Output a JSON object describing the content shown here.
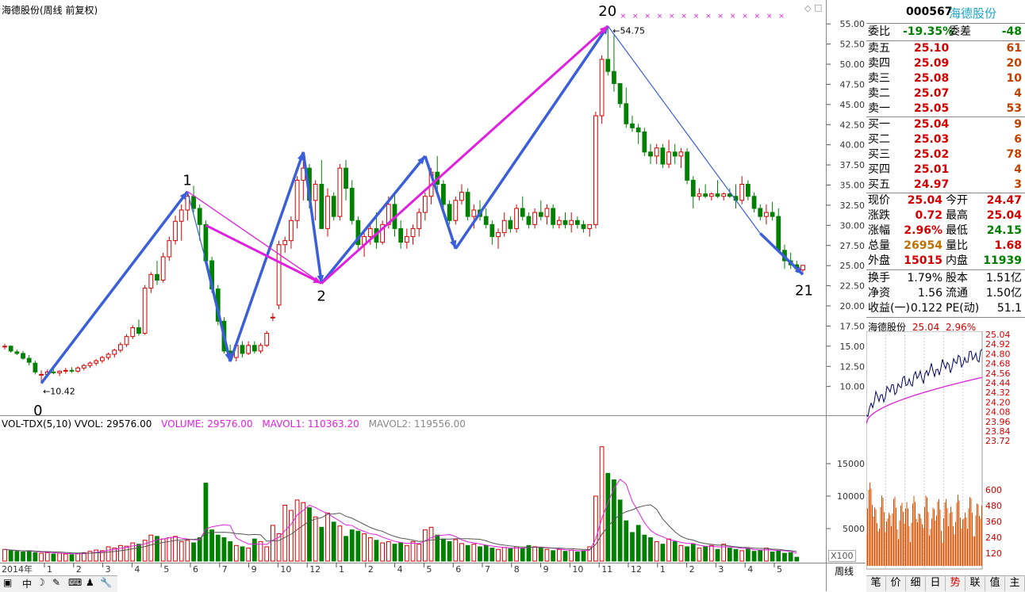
{
  "chart_title": "海德股份(周线 前复权)",
  "vol_indicator": {
    "name": "VOL-TDX(5,10)",
    "vvol_label": "VVOL:",
    "vvol": "29576.00",
    "volume_label": "VOLUME:",
    "volume": "29576.00",
    "mavol1_label": "MAVOL1:",
    "mavol1": "110363.20",
    "mavol2_label": "MAVOL2:",
    "mavol2": "119556.00"
  },
  "annotations": {
    "wave_0": "0",
    "wave_1": "1",
    "wave_2": "2",
    "wave_20": "20",
    "wave_21": "21",
    "low_price": "10.42",
    "high_price": "54.75"
  },
  "x_axis": {
    "year_label": "2014年",
    "months": [
      "1",
      "2",
      "3",
      "4",
      "5",
      "6",
      "7",
      "9",
      "10",
      "12",
      "1",
      "2",
      "4",
      "5",
      "6",
      "7",
      "8",
      "9",
      "10",
      "11",
      "12",
      "1",
      "2",
      "3",
      "4",
      "5"
    ],
    "period_label": "周线",
    "zoom_label": "X100"
  },
  "chart_data": [
    {
      "type": "candlestick",
      "title": "海德股份(周线 前复权)",
      "y_ticks": [
        "55.00",
        "52.50",
        "50.00",
        "47.50",
        "45.00",
        "42.50",
        "40.00",
        "37.50",
        "35.00",
        "32.50",
        "30.00",
        "27.50",
        "25.00",
        "22.50",
        "20.00",
        "17.50",
        "15.00",
        "12.50",
        "10.00"
      ],
      "ylim": [
        8.0,
        56.0
      ],
      "candles": [
        [
          15.0,
          15.3,
          14.6,
          15.0
        ],
        [
          15.0,
          15.1,
          14.2,
          14.4
        ],
        [
          14.3,
          14.6,
          13.9,
          14.1
        ],
        [
          14.1,
          14.4,
          13.3,
          13.5
        ],
        [
          13.5,
          13.9,
          12.6,
          13.0
        ],
        [
          12.9,
          13.2,
          11.5,
          11.8
        ],
        [
          11.5,
          12.0,
          10.4,
          11.5
        ],
        [
          11.5,
          12.1,
          11.2,
          11.8
        ],
        [
          11.8,
          12.3,
          11.5,
          11.7
        ],
        [
          11.7,
          12.0,
          11.3,
          11.9
        ],
        [
          11.9,
          12.3,
          11.6,
          12.0
        ],
        [
          12.0,
          12.4,
          11.7,
          11.9
        ],
        [
          11.9,
          12.5,
          11.7,
          12.3
        ],
        [
          12.3,
          12.8,
          12.0,
          12.6
        ],
        [
          12.6,
          13.1,
          12.3,
          12.9
        ],
        [
          12.9,
          13.4,
          12.6,
          13.2
        ],
        [
          13.2,
          13.8,
          12.9,
          13.6
        ],
        [
          13.6,
          14.2,
          13.3,
          14.0
        ],
        [
          14.0,
          14.7,
          13.6,
          14.5
        ],
        [
          14.5,
          15.5,
          14.2,
          15.2
        ],
        [
          15.2,
          16.5,
          14.9,
          16.2
        ],
        [
          16.2,
          17.6,
          15.9,
          17.3
        ],
        [
          17.3,
          18.3,
          16.3,
          16.6
        ],
        [
          16.6,
          22.6,
          16.4,
          22.2
        ],
        [
          22.2,
          24.2,
          21.6,
          23.9
        ],
        [
          23.9,
          25.6,
          22.6,
          23.2
        ],
        [
          23.2,
          26.6,
          22.9,
          26.1
        ],
        [
          26.1,
          28.6,
          25.6,
          28.1
        ],
        [
          28.1,
          31.2,
          27.6,
          30.5
        ],
        [
          30.5,
          32.6,
          28.1,
          31.9
        ],
        [
          31.9,
          34.2,
          30.6,
          33.6
        ],
        [
          33.6,
          34.9,
          31.6,
          32.1
        ],
        [
          32.1,
          32.6,
          28.1,
          30.1
        ],
        [
          30.1,
          30.6,
          25.1,
          25.6
        ],
        [
          25.6,
          26.1,
          21.6,
          22.1
        ],
        [
          22.1,
          22.6,
          17.6,
          18.1
        ],
        [
          18.1,
          18.6,
          14.1,
          14.4
        ],
        [
          14.4,
          15.2,
          13.1,
          13.6
        ],
        [
          13.6,
          15.6,
          13.1,
          15.1
        ],
        [
          15.1,
          15.6,
          13.6,
          14.1
        ],
        [
          14.1,
          15.6,
          13.9,
          15.1
        ],
        [
          15.1,
          15.6,
          14.1,
          14.4
        ],
        [
          14.4,
          15.4,
          14.1,
          15.1
        ],
        [
          15.1,
          16.9,
          14.9,
          16.6
        ],
        [
          18.6,
          19.1,
          18.1,
          18.6
        ],
        [
          20.1,
          28.1,
          19.6,
          27.6
        ],
        [
          27.6,
          28.6,
          26.6,
          28.1
        ],
        [
          28.1,
          31.1,
          27.1,
          30.6
        ],
        [
          30.6,
          36.1,
          29.6,
          35.6
        ],
        [
          35.6,
          39.1,
          33.1,
          37.1
        ],
        [
          37.1,
          37.6,
          32.1,
          33.1
        ],
        [
          33.1,
          35.6,
          30.6,
          35.1
        ],
        [
          35.1,
          38.1,
          30.1,
          29.6
        ],
        [
          29.6,
          34.6,
          28.6,
          33.6
        ],
        [
          33.6,
          34.1,
          30.6,
          31.1
        ],
        [
          31.1,
          37.6,
          30.6,
          37.1
        ],
        [
          37.1,
          38.1,
          33.1,
          34.6
        ],
        [
          34.6,
          35.6,
          30.1,
          30.6
        ],
        [
          30.6,
          31.1,
          27.1,
          27.6
        ],
        [
          27.6,
          29.1,
          26.1,
          28.6
        ],
        [
          28.6,
          30.1,
          27.6,
          29.6
        ],
        [
          29.6,
          31.6,
          27.1,
          27.9
        ],
        [
          27.9,
          30.6,
          27.6,
          30.1
        ],
        [
          30.1,
          33.6,
          29.6,
          32.6
        ],
        [
          32.6,
          34.1,
          28.6,
          29.6
        ],
        [
          29.6,
          30.6,
          27.1,
          27.9
        ],
        [
          27.9,
          29.6,
          27.1,
          28.6
        ],
        [
          28.6,
          30.1,
          27.6,
          29.6
        ],
        [
          29.6,
          32.1,
          28.6,
          31.6
        ],
        [
          31.6,
          34.1,
          30.6,
          33.6
        ],
        [
          33.6,
          37.1,
          32.6,
          36.6
        ],
        [
          36.6,
          38.6,
          34.1,
          35.1
        ],
        [
          35.1,
          35.6,
          32.1,
          32.6
        ],
        [
          32.6,
          33.1,
          30.1,
          30.6
        ],
        [
          30.6,
          33.6,
          30.1,
          33.1
        ],
        [
          33.1,
          35.1,
          32.6,
          34.1
        ],
        [
          34.1,
          34.6,
          30.6,
          31.1
        ],
        [
          31.1,
          32.6,
          29.6,
          31.9
        ],
        [
          31.9,
          33.1,
          30.6,
          31.1
        ],
        [
          31.1,
          32.1,
          29.6,
          30.1
        ],
        [
          30.1,
          30.6,
          27.6,
          28.6
        ],
        [
          28.6,
          29.6,
          27.1,
          29.1
        ],
        [
          29.1,
          31.6,
          28.6,
          30.6
        ],
        [
          30.6,
          31.1,
          29.1,
          29.6
        ],
        [
          29.6,
          32.6,
          29.1,
          32.1
        ],
        [
          32.1,
          33.6,
          30.6,
          31.1
        ],
        [
          31.1,
          31.6,
          29.6,
          30.1
        ],
        [
          30.1,
          32.1,
          29.6,
          31.6
        ],
        [
          31.6,
          33.1,
          30.6,
          31.1
        ],
        [
          31.1,
          32.6,
          30.1,
          32.1
        ],
        [
          32.1,
          32.6,
          29.6,
          30.1
        ],
        [
          30.1,
          31.1,
          29.6,
          30.6
        ],
        [
          30.6,
          31.6,
          29.6,
          30.1
        ],
        [
          30.1,
          31.6,
          29.1,
          30.6
        ],
        [
          30.6,
          31.1,
          29.6,
          30.1
        ],
        [
          30.1,
          30.6,
          29.1,
          29.6
        ],
        [
          29.6,
          30.1,
          28.6,
          30.1
        ],
        [
          30.1,
          44.1,
          29.6,
          43.6
        ],
        [
          43.6,
          51.1,
          42.6,
          50.6
        ],
        [
          50.6,
          54.75,
          48.6,
          49.1
        ],
        [
          49.1,
          53.6,
          46.6,
          47.6
        ],
        [
          47.6,
          47.6,
          44.6,
          45.1
        ],
        [
          45.1,
          47.1,
          42.1,
          42.6
        ],
        [
          42.6,
          43.6,
          41.6,
          42.1
        ],
        [
          42.1,
          42.6,
          40.1,
          41.6
        ],
        [
          41.6,
          42.1,
          38.6,
          39.1
        ],
        [
          39.1,
          40.1,
          37.6,
          38.6
        ],
        [
          38.6,
          40.1,
          37.6,
          39.6
        ],
        [
          39.6,
          40.1,
          37.1,
          37.6
        ],
        [
          37.6,
          40.6,
          37.1,
          39.1
        ],
        [
          39.1,
          40.1,
          37.6,
          38.6
        ],
        [
          38.6,
          39.6,
          37.1,
          39.1
        ],
        [
          39.1,
          39.6,
          35.1,
          35.6
        ],
        [
          35.6,
          36.1,
          32.1,
          33.6
        ],
        [
          33.6,
          34.6,
          33.1,
          33.9
        ],
        [
          33.9,
          35.1,
          33.4,
          33.6
        ],
        [
          33.6,
          34.1,
          33.1,
          33.9
        ],
        [
          33.9,
          35.6,
          33.4,
          33.6
        ],
        [
          33.6,
          34.1,
          33.1,
          33.9
        ],
        [
          33.9,
          34.6,
          33.4,
          33.6
        ],
        [
          33.6,
          35.1,
          32.1,
          33.1
        ],
        [
          33.1,
          36.1,
          32.6,
          35.1
        ],
        [
          35.1,
          35.6,
          33.1,
          33.6
        ],
        [
          33.6,
          34.1,
          31.6,
          32.1
        ],
        [
          32.1,
          32.6,
          30.6,
          31.1
        ],
        [
          31.1,
          32.6,
          30.1,
          31.6
        ],
        [
          31.6,
          32.9,
          30.6,
          31.1
        ],
        [
          31.1,
          32.1,
          26.6,
          26.9
        ],
        [
          26.9,
          27.6,
          24.6,
          25.6
        ],
        [
          25.6,
          26.6,
          24.6,
          25.1
        ],
        [
          25.1,
          25.6,
          24.1,
          24.6
        ],
        [
          24.47,
          25.04,
          24.15,
          25.04
        ]
      ]
    },
    {
      "type": "bar",
      "title": "VOL-TDX(5,10)",
      "y_ticks": [
        "15000",
        "10000",
        "5000"
      ],
      "ylim": [
        0,
        20000
      ],
      "values": [
        1800,
        1600,
        1500,
        1400,
        1600,
        1300,
        1200,
        1300,
        1100,
        1200,
        1100,
        1000,
        1200,
        1300,
        1500,
        1700,
        1600,
        2200,
        2000,
        2400,
        2300,
        2800,
        2600,
        3200,
        4000,
        3800,
        3400,
        3600,
        3800,
        3000,
        3200,
        2800,
        3600,
        12000,
        4800,
        4000,
        3600,
        3000,
        2400,
        2200,
        2000,
        3400,
        3000,
        2200,
        5500,
        4200,
        8600,
        7800,
        9400,
        9000,
        8200,
        6800,
        5200,
        7400,
        6000,
        5400,
        3800,
        4800,
        4600,
        4200,
        3600,
        3200,
        2800,
        3000,
        2600,
        2800,
        2400,
        3000,
        2600,
        4800,
        5200,
        4000,
        3400,
        3000,
        3300,
        2700,
        2400,
        2600,
        2200,
        2400,
        2000,
        1800,
        2100,
        1900,
        2200,
        2000,
        2400,
        2200,
        2000,
        1800,
        1600,
        1800,
        1500,
        1700,
        1400,
        1600,
        2200,
        10000,
        17600,
        13500,
        12500,
        9400,
        6200,
        4400,
        5500,
        4000,
        3600,
        3000,
        2600,
        3400,
        3000,
        2400,
        2200,
        2600,
        2000,
        2200,
        2400,
        1800,
        2600,
        2000,
        1800,
        1600,
        1900,
        1500,
        1700,
        2000,
        1400,
        1600,
        1200,
        1300,
        600
      ]
    }
  ],
  "quote_panel": {
    "code": "000567",
    "name": "海德股份",
    "weibi_label": "委比",
    "weibi": "-19.35%",
    "weicha_label": "委差",
    "weicha": "-48",
    "asks": [
      {
        "label": "卖五",
        "price": "25.10",
        "vol": "61"
      },
      {
        "label": "卖四",
        "price": "25.09",
        "vol": "20"
      },
      {
        "label": "卖三",
        "price": "25.08",
        "vol": "10"
      },
      {
        "label": "卖二",
        "price": "25.07",
        "vol": "4"
      },
      {
        "label": "卖一",
        "price": "25.05",
        "vol": "53"
      }
    ],
    "bids": [
      {
        "label": "买一",
        "price": "25.04",
        "vol": "9"
      },
      {
        "label": "买二",
        "price": "25.03",
        "vol": "6"
      },
      {
        "label": "买三",
        "price": "25.02",
        "vol": "78"
      },
      {
        "label": "买四",
        "price": "25.01",
        "vol": "4"
      },
      {
        "label": "买五",
        "price": "24.97",
        "vol": "3"
      }
    ],
    "stats": [
      {
        "l1": "现价",
        "v1": "25.04",
        "c1": "red",
        "l2": "今开",
        "v2": "24.47",
        "c2": "red"
      },
      {
        "l1": "涨跌",
        "v1": "0.72",
        "c1": "red",
        "l2": "最高",
        "v2": "25.04",
        "c2": "red"
      },
      {
        "l1": "涨幅",
        "v1": "2.96%",
        "c1": "red",
        "l2": "最低",
        "v2": "24.15",
        "c2": "green"
      },
      {
        "l1": "总量",
        "v1": "26954",
        "c1": "orange",
        "l2": "量比",
        "v2": "1.68",
        "c2": "red"
      },
      {
        "l1": "外盘",
        "v1": "15015",
        "c1": "red",
        "l2": "内盘",
        "v2": "11939",
        "c2": "green"
      }
    ],
    "finance": [
      {
        "l1": "换手",
        "v1": "1.79%",
        "l2": "股本",
        "v2": "1.51亿"
      },
      {
        "l1": "净资",
        "v1": "1.56",
        "l2": "流通",
        "v2": "1.50亿"
      },
      {
        "l1": "收益(一)",
        "v1": "0.122",
        "l2": "PE(动)",
        "v2": "51.1"
      }
    ]
  },
  "intraday": {
    "name": "海德股份",
    "price": "25.04",
    "pct": "2.96%",
    "price_ticks": [
      "25.04",
      "24.92",
      "24.80",
      "24.68",
      "24.56",
      "24.44",
      "24.32",
      "24.20",
      "24.08",
      "23.96",
      "23.84",
      "23.72"
    ],
    "vol_ticks": [
      "600",
      "480",
      "360",
      "240",
      "120"
    ]
  },
  "bottom_tabs": [
    "笔",
    "价",
    "细",
    "日",
    "势",
    "联",
    "值",
    "主"
  ],
  "active_tab": "势",
  "toolbar_icons": [
    "chart-icon",
    "zhong-label",
    "moon-icon",
    "pen-icon",
    "keyboard-icon",
    "person-icon",
    "wrench-icon"
  ],
  "zhong_label": "中",
  "colors": {
    "up": "#d40000",
    "down": "#008000",
    "wave_arrow": "#3a5fd8",
    "pink": "#e020e0"
  }
}
